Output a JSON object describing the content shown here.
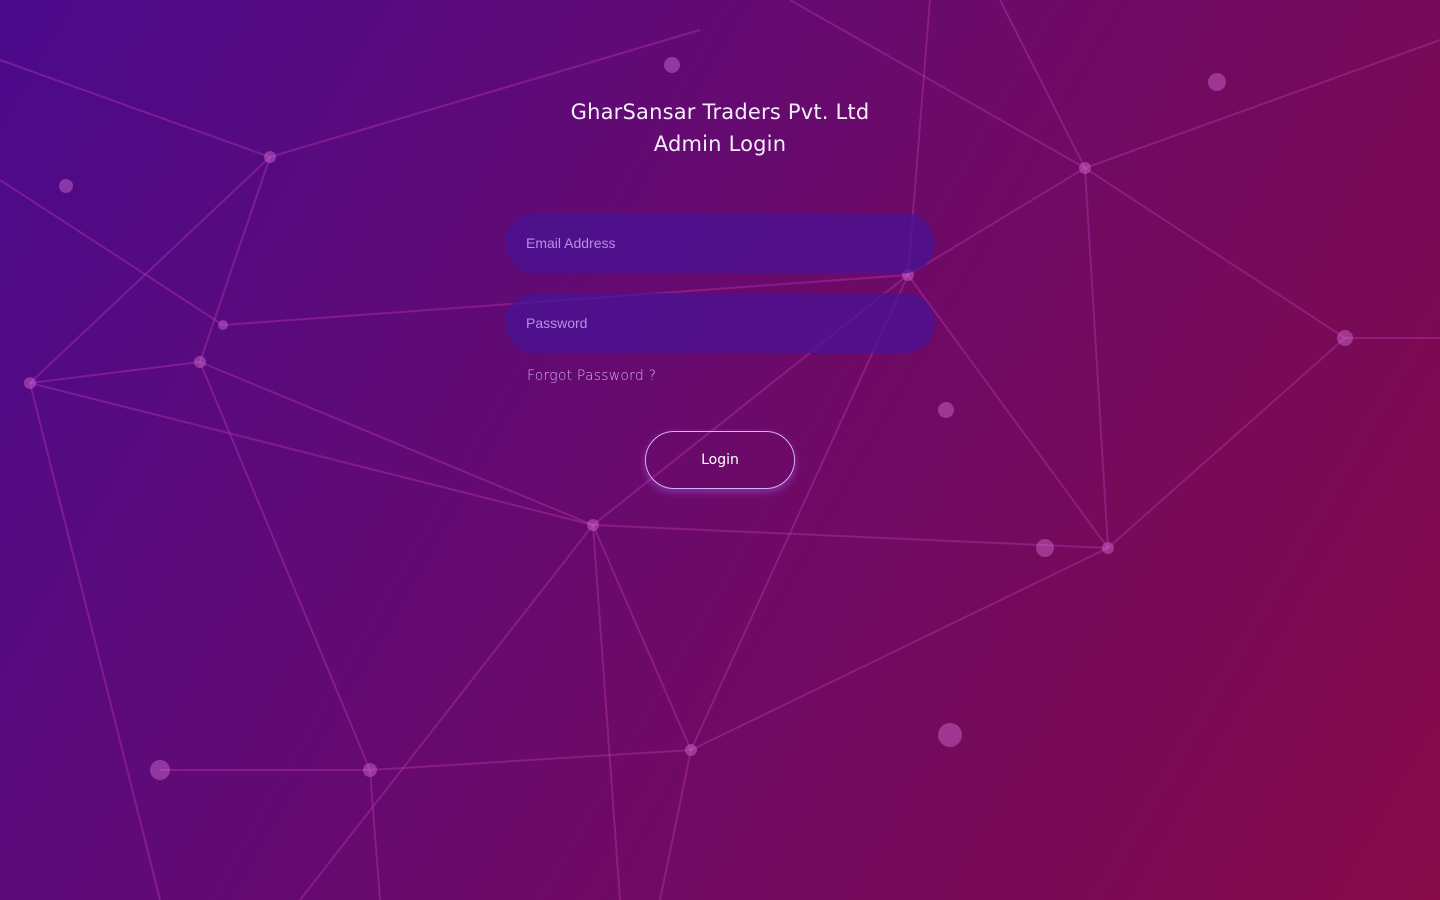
{
  "header": {
    "company_name": "GharSansar Traders Pvt. Ltd",
    "page_title": "Admin Login"
  },
  "form": {
    "email": {
      "value": "",
      "placeholder": "Email Address"
    },
    "password": {
      "value": "",
      "placeholder": "Password"
    },
    "forgot_label": "Forgot Password ?",
    "login_label": "Login"
  },
  "colors": {
    "gradient_start": "#4a0a8c",
    "gradient_end": "#860a48",
    "input_bg": "#481496",
    "button_border": "#d5b2f2"
  }
}
